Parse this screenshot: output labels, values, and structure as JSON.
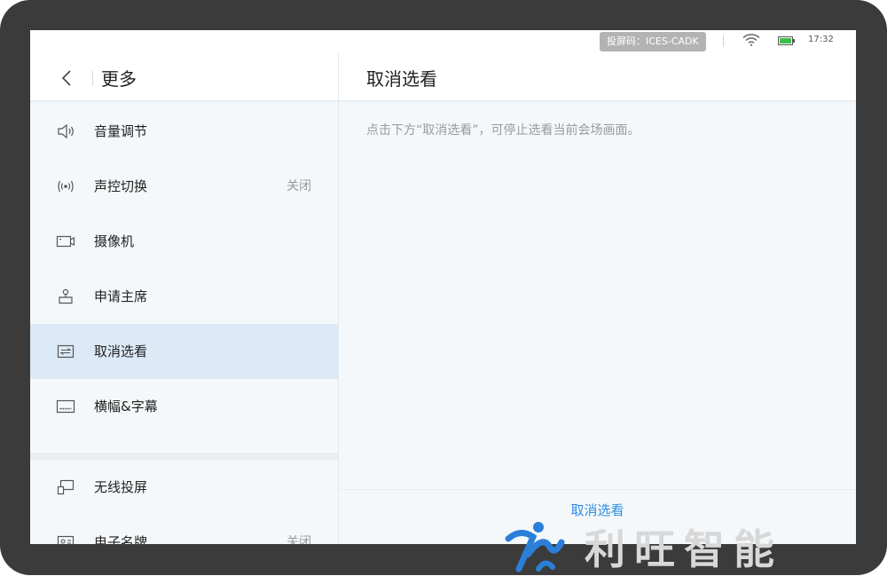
{
  "status_bar": {
    "cast_code": "投屏码：ICES-CADK",
    "time": "17:32"
  },
  "left": {
    "title": "更多",
    "items": [
      {
        "label": "音量调节",
        "value": "",
        "icon": "speaker-icon"
      },
      {
        "label": "声控切换",
        "value": "关闭",
        "icon": "voice-signal-icon"
      },
      {
        "label": "摄像机",
        "value": "",
        "icon": "camera-icon"
      },
      {
        "label": "申请主席",
        "value": "",
        "icon": "chair-apply-icon"
      },
      {
        "label": "取消选看",
        "value": "",
        "icon": "switch-icon"
      },
      {
        "label": "横幅&字幕",
        "value": "",
        "icon": "subtitle-icon"
      },
      {
        "label": "无线投屏",
        "value": "",
        "icon": "wireless-cast-icon"
      },
      {
        "label": "电子名牌",
        "value": "关闭",
        "icon": "name-card-icon"
      }
    ]
  },
  "right": {
    "title": "取消选看",
    "description": "点击下方“取消选看”，可停止选看当前会场画面。",
    "action_label": "取消选看"
  },
  "watermark": {
    "text": "利旺智能"
  },
  "colors": {
    "accent": "#2b8de6",
    "active_row": "#dce9f6",
    "bezel": "#3b3b3b"
  }
}
